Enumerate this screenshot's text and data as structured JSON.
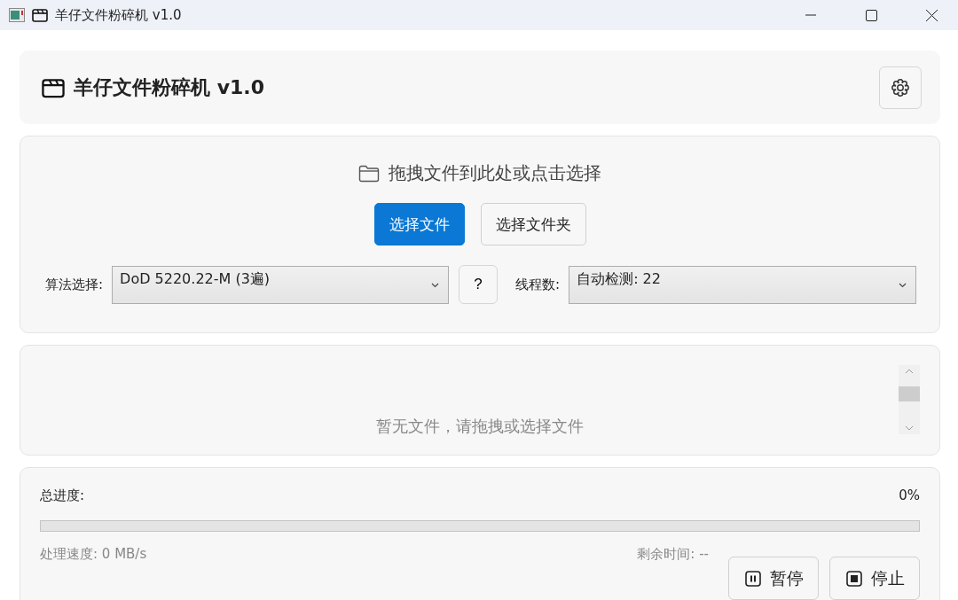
{
  "window": {
    "title": "羊仔文件粉碎机 v1.0"
  },
  "header": {
    "title": "羊仔文件粉碎机 v1.0"
  },
  "drop_zone": {
    "hint": "拖拽文件到此处或点击选择",
    "buttons": [
      {
        "label": "选择文件",
        "primary": true
      },
      {
        "label": "选择文件夹",
        "primary": false
      }
    ]
  },
  "algorithm": {
    "label": "算法选择:",
    "value": "DoD 5220.22-M (3遍)",
    "help": "?"
  },
  "threads": {
    "label": "线程数:",
    "value": "自动检测: 22"
  },
  "file_list": {
    "empty_text": "暂无文件，请拖拽或选择文件"
  },
  "progress": {
    "label": "总进度:",
    "percent": "0%",
    "level": 0,
    "speed": "处理速度: 0 MB/s",
    "remaining": "剩余时间: --",
    "buttons": [
      {
        "label": "暂停",
        "kind": "pause"
      },
      {
        "label": "停止",
        "kind": "stop"
      }
    ]
  }
}
